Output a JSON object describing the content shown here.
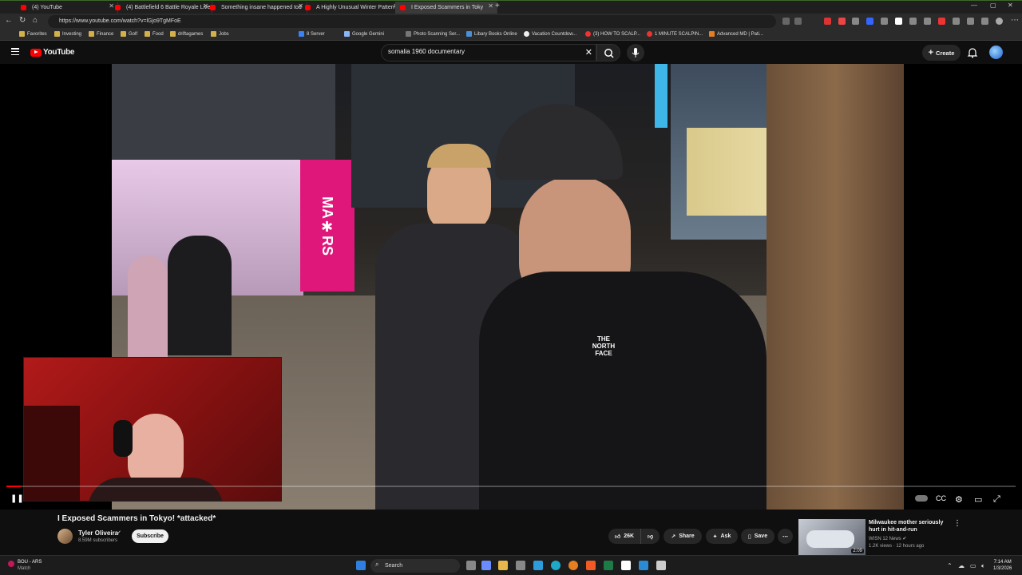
{
  "browser": {
    "tabs": [
      {
        "label": "(4) YouTube",
        "active": false
      },
      {
        "label": "(4) Battlefield 6 Battle Royale Live",
        "active": false
      },
      {
        "label": "Something insane happened tod",
        "active": false
      },
      {
        "label": "A Highly Unusual Winter Pattern",
        "active": false
      },
      {
        "label": "I Exposed Scammers in Toky",
        "active": true
      }
    ],
    "url": "https://www.youtube.com/watch?v=lGjo9TgMFoE",
    "bookmarks": [
      "Favorites",
      "Investing",
      "Finance",
      "Golf",
      "Food",
      "driftagames",
      "Jobs",
      "8 Server",
      "Google Gemini",
      "Photo Scanning Ser...",
      "Libary Books Online",
      "Vacation Countdow...",
      "(3) HOW TO SCALP...",
      "1 MINUTE SCALPIN...",
      "Advanced MD | Pati..."
    ]
  },
  "youtube": {
    "logo": "YouTube",
    "search": {
      "value": "somalia 1960 documentary"
    },
    "create_label": "Create"
  },
  "player": {
    "progress_fraction": 0.014,
    "overlay_text": "MA✱RS"
  },
  "video": {
    "title": "I Exposed Scammers in Tokyo! *attacked*",
    "channel": "Tyler Oliveira",
    "verified": "✔",
    "subscribers": "8.59M subscribers",
    "subscribe_label": "Subscribe",
    "likes": "26K",
    "share_label": "Share",
    "ask_label": "Ask",
    "save_label": "Save"
  },
  "recommendation": {
    "title": "Milwaukee mother seriously hurt in hit-and-run",
    "channel": "WISN 12 News ✔",
    "meta": "1.2K views · 12 hours ago",
    "duration": "2:09"
  },
  "taskbar": {
    "weather_line1": "BOU - ARS",
    "weather_line2": "Match",
    "search_placeholder": "Search",
    "time": "7:14 AM",
    "date": "1/3/2026"
  },
  "colors": {
    "brand_red": "#ff0000",
    "bg": "#0f0f0f",
    "pill": "#272727"
  }
}
